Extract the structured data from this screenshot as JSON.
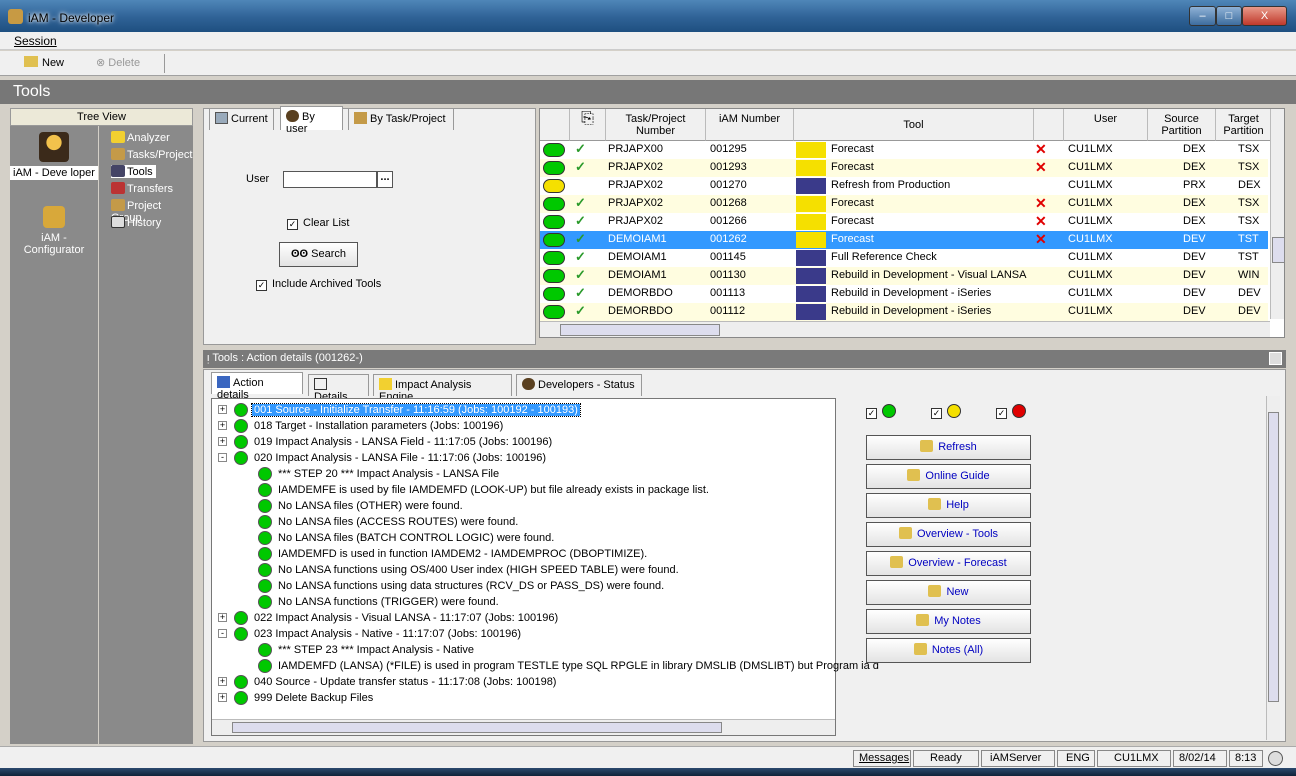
{
  "window": {
    "title": "iAM - Developer",
    "min": "–",
    "max": "□",
    "close": "X"
  },
  "menu": {
    "session": "Session"
  },
  "toolbar": {
    "new": "New",
    "delete": "Delete"
  },
  "section_title": "Tools",
  "tree_view": {
    "header": "Tree View",
    "apps": [
      {
        "label": "iAM - Deve loper"
      },
      {
        "label": "iAM - Configurator"
      }
    ],
    "items": [
      "Analyzer",
      "Tasks/Project",
      "Tools",
      "Transfers",
      "Project Group",
      "History"
    ]
  },
  "filter": {
    "tabs": [
      "Current",
      "By user",
      "By Task/Project"
    ],
    "user_label": "User",
    "user_value": "",
    "lookup_button": "...",
    "clear_list_label": "Clear List",
    "search_button": "Search",
    "include_archived_label": "Include Archived Tools"
  },
  "grid": {
    "headers": [
      "Task/Project Number",
      "iAM Number",
      "Tool",
      "User",
      "Source Partition",
      "Target Partition"
    ],
    "rows": [
      {
        "status": "green",
        "check": true,
        "task": "PRJAPX00",
        "iam": "001295",
        "tool": "Forecast",
        "x": true,
        "user": "CU1LMX",
        "src": "DEX",
        "tgt": "TSX",
        "bg": "#ffffff"
      },
      {
        "status": "green",
        "check": true,
        "task": "PRJAPX02",
        "iam": "001293",
        "tool": "Forecast",
        "x": true,
        "user": "CU1LMX",
        "src": "DEX",
        "tgt": "TSX",
        "bg": "#fffde0"
      },
      {
        "status": "yellow",
        "check": false,
        "task": "PRJAPX02",
        "iam": "001270",
        "tool": "Refresh from Production",
        "x": false,
        "user": "CU1LMX",
        "src": "PRX",
        "tgt": "DEX",
        "bg": "#ffffff"
      },
      {
        "status": "green",
        "check": true,
        "task": "PRJAPX02",
        "iam": "001268",
        "tool": "Forecast",
        "x": true,
        "user": "CU1LMX",
        "src": "DEX",
        "tgt": "TSX",
        "bg": "#fffde0"
      },
      {
        "status": "green",
        "check": true,
        "task": "PRJAPX02",
        "iam": "001266",
        "tool": "Forecast",
        "x": true,
        "user": "CU1LMX",
        "src": "DEX",
        "tgt": "TSX",
        "bg": "#ffffff"
      },
      {
        "status": "green",
        "check": true,
        "task": "DEMOIAM1",
        "iam": "001262",
        "tool": "Forecast",
        "x": true,
        "user": "CU1LMX",
        "src": "DEV",
        "tgt": "TST",
        "bg": "#3399ff",
        "selected": true
      },
      {
        "status": "green",
        "check": true,
        "task": "DEMOIAM1",
        "iam": "001145",
        "tool": "Full Reference Check",
        "x": false,
        "user": "CU1LMX",
        "src": "DEV",
        "tgt": "TST",
        "bg": "#ffffff"
      },
      {
        "status": "green",
        "check": true,
        "task": "DEMOIAM1",
        "iam": "001130",
        "tool": "Rebuild in Development - Visual LANSA",
        "x": false,
        "user": "CU1LMX",
        "src": "DEV",
        "tgt": "WIN",
        "bg": "#fffde0"
      },
      {
        "status": "green",
        "check": true,
        "task": "DEMORBDO",
        "iam": "001113",
        "tool": "Rebuild in Development - iSeries",
        "x": false,
        "user": "CU1LMX",
        "src": "DEV",
        "tgt": "DEV",
        "bg": "#ffffff"
      },
      {
        "status": "green",
        "check": true,
        "task": "DEMORBDO",
        "iam": "001112",
        "tool": "Rebuild in Development - iSeries",
        "x": false,
        "user": "CU1LMX",
        "src": "DEV",
        "tgt": "DEV",
        "bg": "#fffde0"
      }
    ]
  },
  "detail": {
    "title": "Tools : Action details (001262-)",
    "tabs": [
      "Action details",
      "Details",
      "Impact Analysis Engine",
      "Developers - Status"
    ],
    "lines": [
      {
        "lvl": 0,
        "exp": "+",
        "text": "001 Source - Initialize Transfer - 11:16:59 (Jobs: 100192 - 100193)",
        "sel": true
      },
      {
        "lvl": 0,
        "exp": "+",
        "text": "018 Target - Installation parameters (Jobs: 100196)"
      },
      {
        "lvl": 0,
        "exp": "+",
        "text": "019 Impact Analysis - LANSA Field - 11:17:05 (Jobs: 100196)"
      },
      {
        "lvl": 0,
        "exp": "-",
        "text": "020 Impact Analysis - LANSA File - 11:17:06 (Jobs: 100196)"
      },
      {
        "lvl": 1,
        "text": "*** STEP 20 *** Impact Analysis - LANSA File"
      },
      {
        "lvl": 1,
        "text": "IAMDEMFE is used by file IAMDEMFD (LOOK-UP) but file already exists in package list."
      },
      {
        "lvl": 1,
        "text": "No LANSA files (OTHER) were found."
      },
      {
        "lvl": 1,
        "text": "No LANSA files (ACCESS ROUTES) were found."
      },
      {
        "lvl": 1,
        "text": "No LANSA files (BATCH CONTROL LOGIC) were found."
      },
      {
        "lvl": 1,
        "text": "IAMDEMFD is used in function IAMDEM2 - IAMDEMPROC (DBOPTIMIZE)."
      },
      {
        "lvl": 1,
        "text": "No LANSA functions using OS/400 User index (HIGH SPEED TABLE) were found."
      },
      {
        "lvl": 1,
        "text": "No LANSA functions using data structures (RCV_DS or PASS_DS) were found."
      },
      {
        "lvl": 1,
        "text": "No LANSA functions (TRIGGER) were found."
      },
      {
        "lvl": 0,
        "exp": "+",
        "text": "022 Impact Analysis - Visual LANSA - 11:17:07 (Jobs: 100196)"
      },
      {
        "lvl": 0,
        "exp": "-",
        "text": "023 Impact Analysis - Native - 11:17:07 (Jobs: 100196)"
      },
      {
        "lvl": 1,
        "text": "*** STEP 23 *** Impact Analysis - Native"
      },
      {
        "lvl": 1,
        "text": "IAMDEMFD (LANSA) (*FILE) is used in program TESTLE type SQL RPGLE in library DMSLIB (DMSLIBT) but Program ia d"
      },
      {
        "lvl": 0,
        "exp": "+",
        "text": "040 Source - Update transfer status - 11:17:08 (Jobs: 100198)"
      },
      {
        "lvl": 0,
        "exp": "+",
        "text": "999 Delete Backup Files"
      }
    ],
    "buttons": [
      "Refresh",
      "Online Guide",
      "Help",
      "Overview - Tools",
      "Overview - Forecast",
      "New",
      "My Notes",
      "Notes (All)"
    ]
  },
  "status": {
    "messages": "Messages",
    "ready": "Ready",
    "server": "iAMServer",
    "lang": "ENG",
    "user": "CU1LMX",
    "date": "8/02/14",
    "time": "8:13"
  }
}
